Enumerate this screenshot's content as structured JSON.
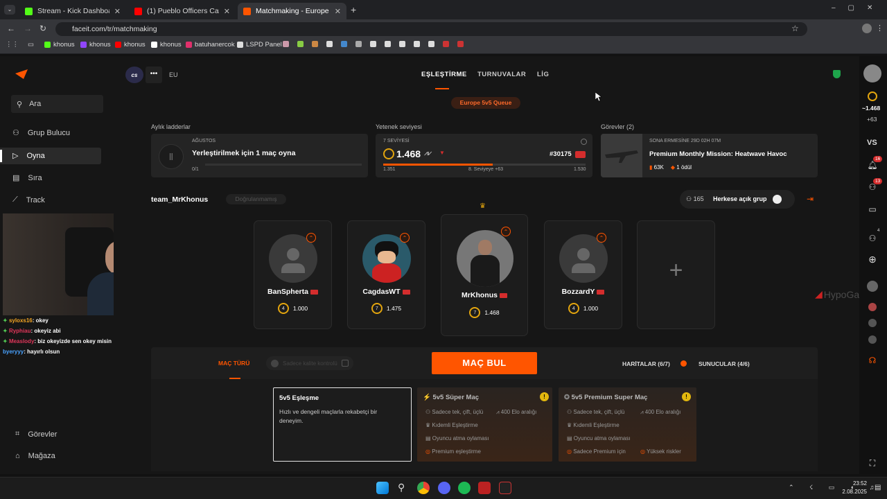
{
  "browser": {
    "tabs": [
      {
        "label": "Stream - Kick Dashboard"
      },
      {
        "label": "(1) Pueblo Officers Catch Biker"
      },
      {
        "label": "Matchmaking - Europe 5v5 Qu"
      }
    ],
    "url": "faceit.com/tr/matchmaking",
    "bookmarks": [
      "khonus",
      "khonus",
      "khonus",
      "khonus",
      "batuhanercok",
      "LSPD Panel"
    ]
  },
  "sidebar": {
    "search": "Ara",
    "items": [
      {
        "label": "Grup Bulucu"
      },
      {
        "label": "Oyna"
      },
      {
        "label": "Sıra"
      },
      {
        "label": "Track"
      }
    ],
    "bottom": [
      {
        "label": "Görevler"
      },
      {
        "label": "Mağaza"
      }
    ]
  },
  "header": {
    "region": "EU",
    "tabs": [
      "EŞLEŞTİRME",
      "TURNUVALAR",
      "LİG"
    ],
    "queue": "Europe 5v5 Queue"
  },
  "ladder": {
    "label": "Aylık ladderlar",
    "month": "AĞUSTOS",
    "text": "Yerleştirilmek için 1 maç oyna",
    "progress": "0/1"
  },
  "skill": {
    "label": "Yetenek seviyesi",
    "level": "7 SEVİYESİ",
    "elo": "1.468",
    "rank": "#30175",
    "min": "1.351",
    "next": "8. Seviyeye +63",
    "max": "1.530",
    "progress": 0.54
  },
  "missions": {
    "label": "Görevler (2)",
    "expires": "SONA ERMESİNE 29D 02H 07M",
    "title": "Premium Monthly Mission: Heatwave Havoc",
    "reward1": "63K",
    "reward2": "1 ödül"
  },
  "team": {
    "name": "team_MrKhonus",
    "status": "Doğrulanmamış",
    "count": "165",
    "open_label": "Herkese açık grup"
  },
  "players": [
    {
      "name": "BanSpherta",
      "level": "4",
      "elo": "1.000"
    },
    {
      "name": "CagdasWT",
      "level": "7",
      "elo": "1.475"
    },
    {
      "name": "MrKhonus",
      "level": "7",
      "elo": "1.468"
    },
    {
      "name": "BozzardY",
      "level": "4",
      "elo": "1.000"
    }
  ],
  "matchbar": {
    "type_label": "MAÇ TÜRÜ",
    "find": "MAÇ BUL",
    "maps": "HARİTALAR (6/7)",
    "servers": "SUNUCULAR (4/6)",
    "filter": "Sadece kalite kontrolü"
  },
  "modes": [
    {
      "title": "5v5 Eşleşme",
      "desc": "Hızlı ve dengeli maçlarla rekabetçi bir deneyim."
    },
    {
      "title": "5v5 Süper Maç",
      "f1": "Sadece tek, çift, üçlü",
      "f2": "400 Elo aralığı",
      "f3": "Kıdemli Eşleştirme",
      "f4": "Oyuncu atma oylaması",
      "f5": "Premium eşleştirme"
    },
    {
      "title": "5v5 Premium Super Maç",
      "f1": "Sadece tek, çift, üçlü",
      "f2": "400 Elo aralığı",
      "f3": "Kıdemli Eşleştirme",
      "f4": "Oyuncu atma oylaması",
      "f5": "Sadece Premium için",
      "f6": "Yüksek riskler"
    }
  ],
  "rightbar": {
    "elo": "1.468",
    "delta": "+63",
    "vs": "VS",
    "notif": "16",
    "friends": "13",
    "party": "4"
  },
  "chat": [
    {
      "user": "syloxs16",
      "msg": ": okey",
      "color": "#f5a623"
    },
    {
      "user": "Ryphiau",
      "msg": ": okeyiz abi",
      "color": "#e0365a"
    },
    {
      "user": "Measlody",
      "msg": ": biz okeyizde sen okey misin",
      "color": "#e0365a"
    },
    {
      "user": "byeryyy",
      "msg": ": hayırlı olsun",
      "color": "#4aa3ff"
    }
  ],
  "overlay_brand": "HypoGame",
  "clock": {
    "time": "23:52",
    "date": "2.08.2025"
  },
  "colors": {
    "accent": "#ff5500",
    "bg": "#161616",
    "card": "#242424"
  }
}
